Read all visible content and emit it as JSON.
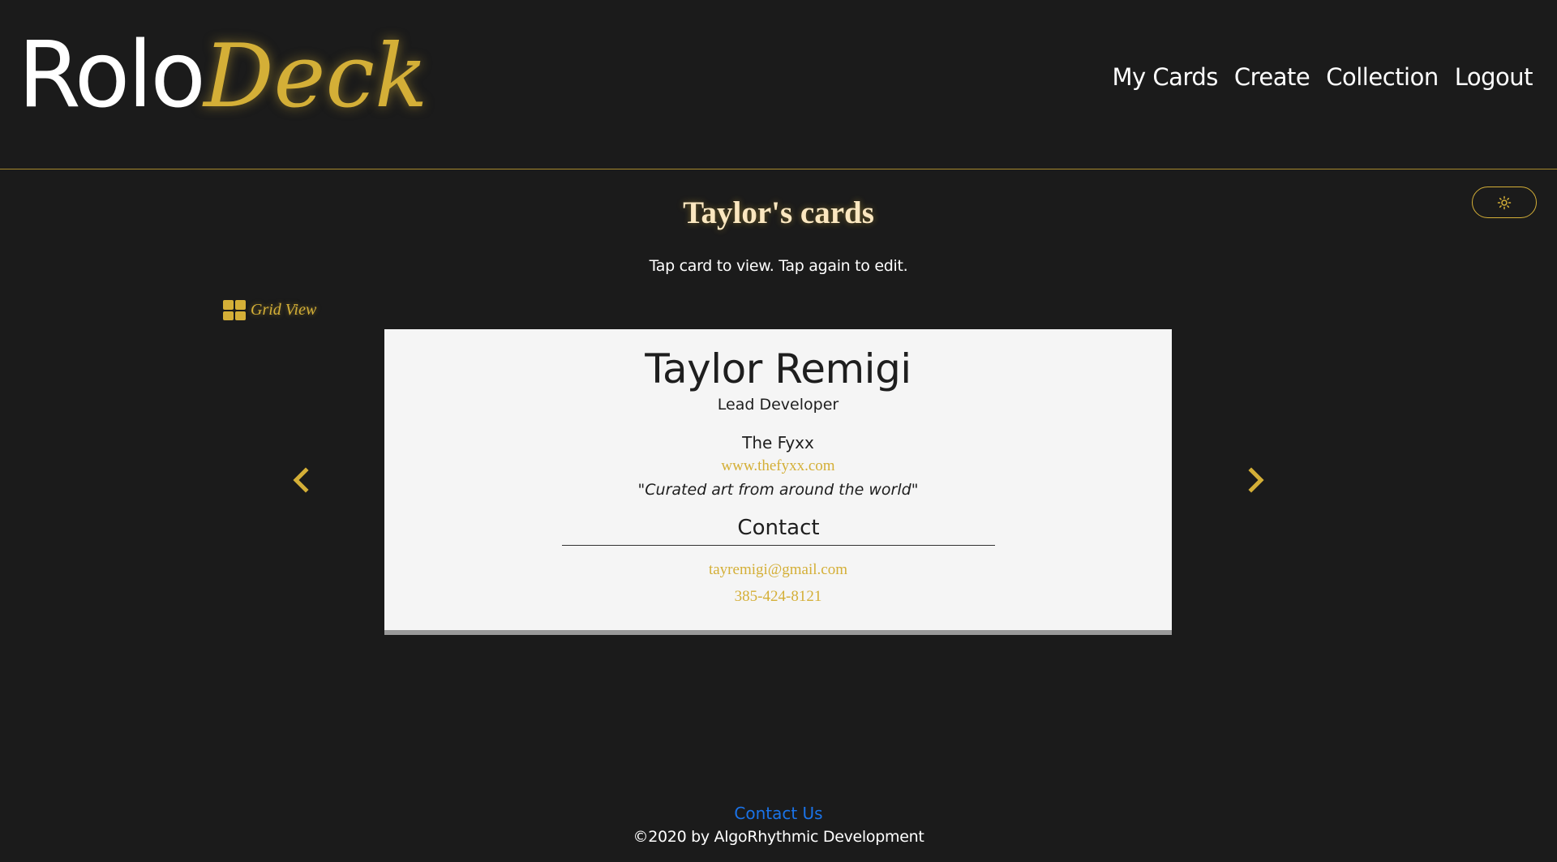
{
  "app": {
    "logo_part1": "Rolo",
    "logo_part2": "Deck"
  },
  "nav": {
    "items": [
      {
        "label": "My Cards"
      },
      {
        "label": "Create"
      },
      {
        "label": "Collection"
      },
      {
        "label": "Logout"
      }
    ]
  },
  "theme_toggle": {
    "icon": "sun-icon"
  },
  "page": {
    "title": "Taylor's cards",
    "subtitle": "Tap card to view. Tap again to edit.",
    "grid_view_label": "Grid View"
  },
  "card": {
    "name": "Taylor Remigi",
    "role": "Lead Developer",
    "company": "The Fyxx",
    "website": "www.thefyxx.com",
    "tagline": "\"Curated art from around the world\"",
    "contact_heading": "Contact",
    "email": "tayremigi@gmail.com",
    "phone": "385-424-8121"
  },
  "footer": {
    "contact_label": "Contact Us",
    "copyright": "©2020 by AlgoRhythmic Development"
  },
  "colors": {
    "background": "#1b1b1b",
    "accent_gold": "#d4af37",
    "card_background": "#f5f5f5",
    "link_blue": "#1a73e8"
  }
}
